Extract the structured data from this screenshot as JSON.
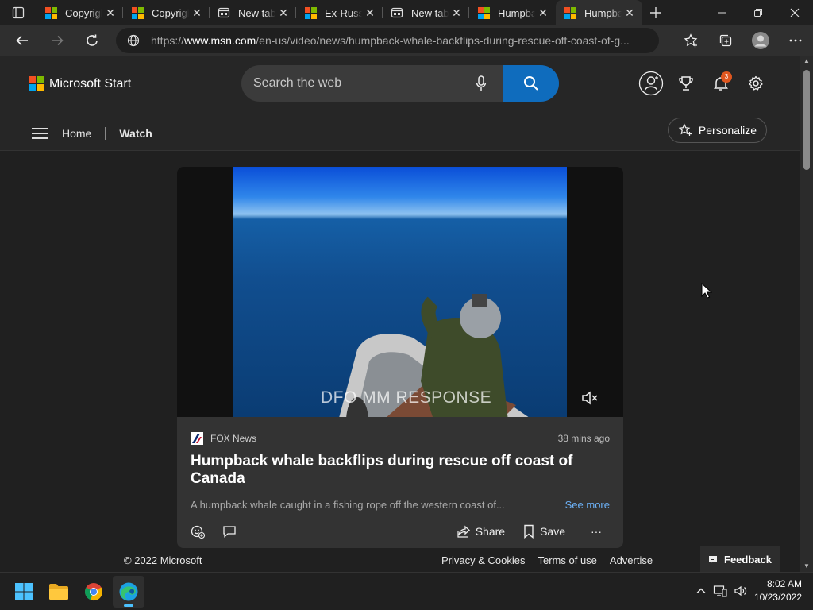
{
  "browser": {
    "tabs": [
      {
        "title": "Copyright",
        "favicon": "microsoft-logo"
      },
      {
        "title": "Copyright",
        "favicon": "microsoft-logo"
      },
      {
        "title": "New tab",
        "favicon": "new-tab-icon"
      },
      {
        "title": "Ex-Russian",
        "favicon": "microsoft-logo"
      },
      {
        "title": "New tab",
        "favicon": "new-tab-icon"
      },
      {
        "title": "Humpback",
        "favicon": "microsoft-logo"
      },
      {
        "title": "Humpback",
        "favicon": "microsoft-logo",
        "active": true
      }
    ],
    "url": {
      "scheme": "https://",
      "host": "www.msn.com",
      "path": "/en-us/video/news/humpback-whale-backflips-during-rescue-off-coast-of-g..."
    }
  },
  "header": {
    "brand": "Microsoft Start",
    "search_placeholder": "Search the web",
    "notification_count": "3"
  },
  "subnav": {
    "home": "Home",
    "watch": "Watch",
    "personalize": "Personalize"
  },
  "card": {
    "watermark": "DFO MM RESPONSE",
    "source": "FOX News",
    "time_ago": "38 mins ago",
    "headline": "Humpback whale backflips during rescue off coast of Canada",
    "description": "A humpback whale caught in a fishing rope off the western coast of...",
    "see_more": "See more",
    "share": "Share",
    "save": "Save",
    "more": "···"
  },
  "footer": {
    "copyright": "© 2022 Microsoft",
    "privacy": "Privacy & Cookies",
    "terms": "Terms of use",
    "advertise": "Advertise",
    "feedback": "Feedback"
  },
  "taskbar": {
    "time": "8:02 AM",
    "date": "10/23/2022"
  },
  "colors": {
    "accent": "#0f6cbd",
    "badge": "#e0571f",
    "link": "#6cb0f5"
  }
}
